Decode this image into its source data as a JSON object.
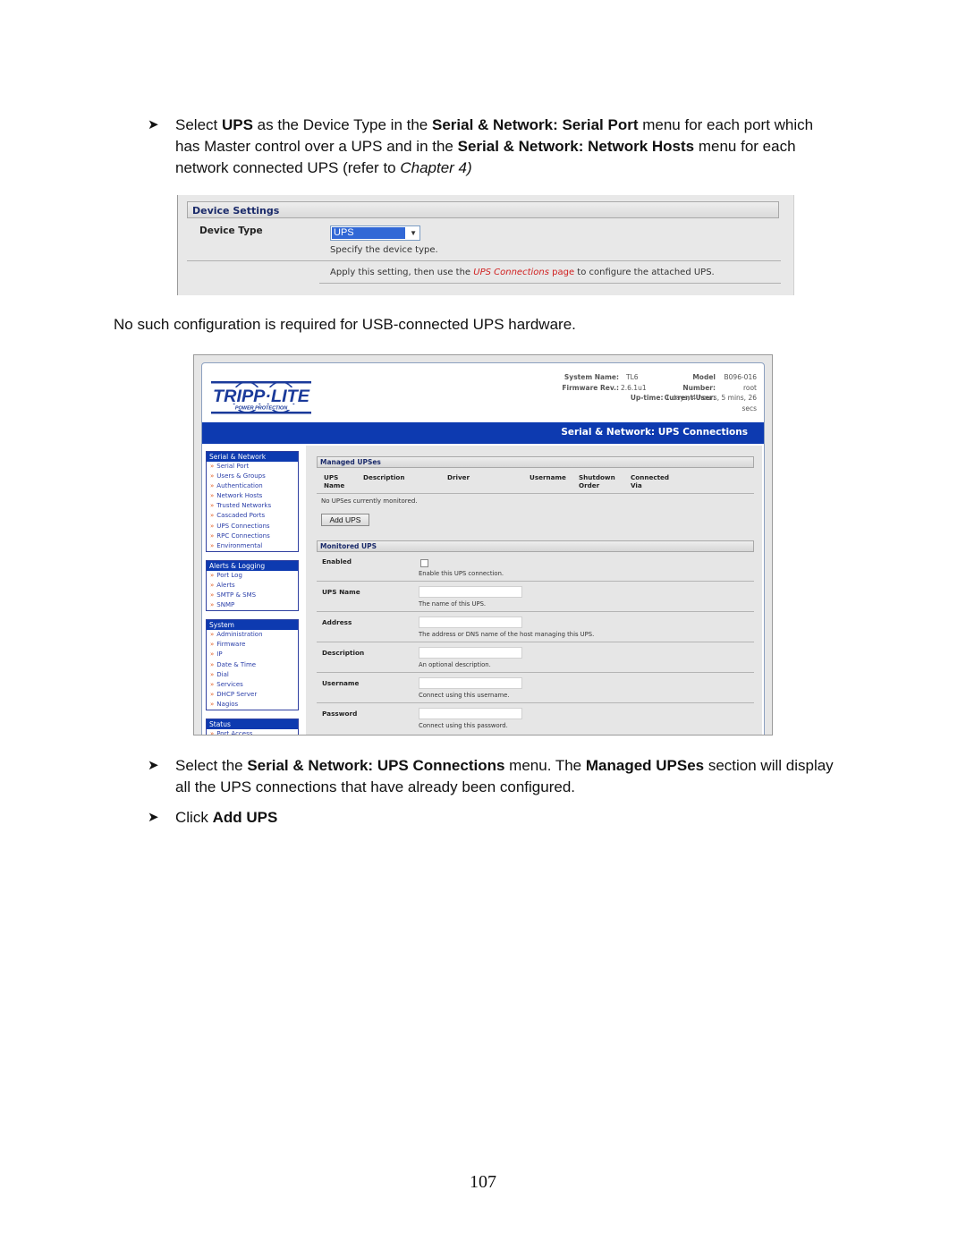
{
  "paragraphs": {
    "step1": {
      "bullet_icon": "arrowhead-bullet",
      "t1": "Select ",
      "b1": "UPS",
      "t2": " as the Device Type in the ",
      "b2": "Serial & Network: Serial Port",
      "t3": " menu for each port which",
      "t4": "has Master control over a UPS and in the ",
      "b3": "Serial & Network: Network Hosts",
      "t5": " menu for each",
      "t6": "network connected UPS (refer to ",
      "i1": "Chapter 4)"
    },
    "usb_note": "No such configuration is required for USB-connected UPS hardware.",
    "step2": {
      "t1": "Select the ",
      "b1": "Serial & Network: UPS Connections",
      "t2": " menu. The ",
      "b2": "Managed UPSes",
      "t3": " section will display",
      "t4": "all the UPS connections that have already been configured."
    },
    "step3": {
      "t1": "Click ",
      "b1": "Add UPS"
    }
  },
  "device_settings": {
    "section_title": "Device Settings",
    "device_type_label": "Device Type",
    "device_type_value": "UPS",
    "device_type_help": "Specify the device type.",
    "apply_t1": "Apply this setting, then use the ",
    "apply_link": "UPS Connections",
    "apply_link2": " page",
    "apply_t2": " to configure the attached UPS."
  },
  "ui": {
    "logo": {
      "brand": "TRIPP·LITE",
      "tagline": "POWER PROTECTION"
    },
    "system_info": {
      "system_name_label": "System Name:",
      "system_name": "TL6",
      "firmware_label": "Firmware Rev.:",
      "firmware": "2.6.1u1",
      "model_label": "Model Number:",
      "model": "B096-016",
      "user_label": "Current User:",
      "user": "root",
      "uptime_label": "Up-time:",
      "uptime": "1 days, 4 hours, 5 mins, 26 secs"
    },
    "page_title": "Serial & Network: UPS Connections",
    "sidebar": [
      {
        "title": "Serial & Network",
        "items": [
          "Serial Port",
          "Users & Groups",
          "Authentication",
          "Network Hosts",
          "Trusted Networks",
          "Cascaded Ports",
          "UPS Connections",
          "RPC Connections",
          "Environmental"
        ]
      },
      {
        "title": "Alerts & Logging",
        "items": [
          "Port Log",
          "Alerts",
          "SMTP & SMS",
          "SNMP"
        ]
      },
      {
        "title": "System",
        "items": [
          "Administration",
          "Firmware",
          "IP",
          "Date & Time",
          "Dial",
          "Services",
          "DHCP Server",
          "Nagios"
        ]
      },
      {
        "title": "Status",
        "items": [
          "Port Access"
        ]
      }
    ],
    "managed": {
      "title": "Managed UPSes",
      "columns": [
        "UPS\nName",
        "Description",
        "Driver",
        "Username",
        "Shutdown\nOrder",
        "Connected\nVia"
      ],
      "col_ups_1": "UPS",
      "col_ups_2": "Name",
      "col_desc": "Description",
      "col_driver": "Driver",
      "col_user": "Username",
      "col_shut_1": "Shutdown",
      "col_shut_2": "Order",
      "col_conn_1": "Connected",
      "col_conn_2": "Via",
      "empty_text": "No UPSes currently monitored.",
      "add_button": "Add UPS"
    },
    "monitored": {
      "title": "Monitored UPS",
      "fields": [
        {
          "label": "Enabled",
          "type": "checkbox",
          "checked": false,
          "help": "Enable this UPS connection."
        },
        {
          "label": "UPS Name",
          "type": "text",
          "value": "",
          "help": "The name of this UPS."
        },
        {
          "label": "Address",
          "type": "text",
          "value": "",
          "help": "The address or DNS name of the host managing this UPS."
        },
        {
          "label": "Description",
          "type": "text",
          "value": "",
          "help": "An optional description."
        },
        {
          "label": "Username",
          "type": "text",
          "value": "",
          "help": "Connect using this username."
        },
        {
          "label": "Password",
          "type": "password",
          "value": "",
          "help": "Connect using this password."
        }
      ]
    }
  },
  "page_number": "107"
}
